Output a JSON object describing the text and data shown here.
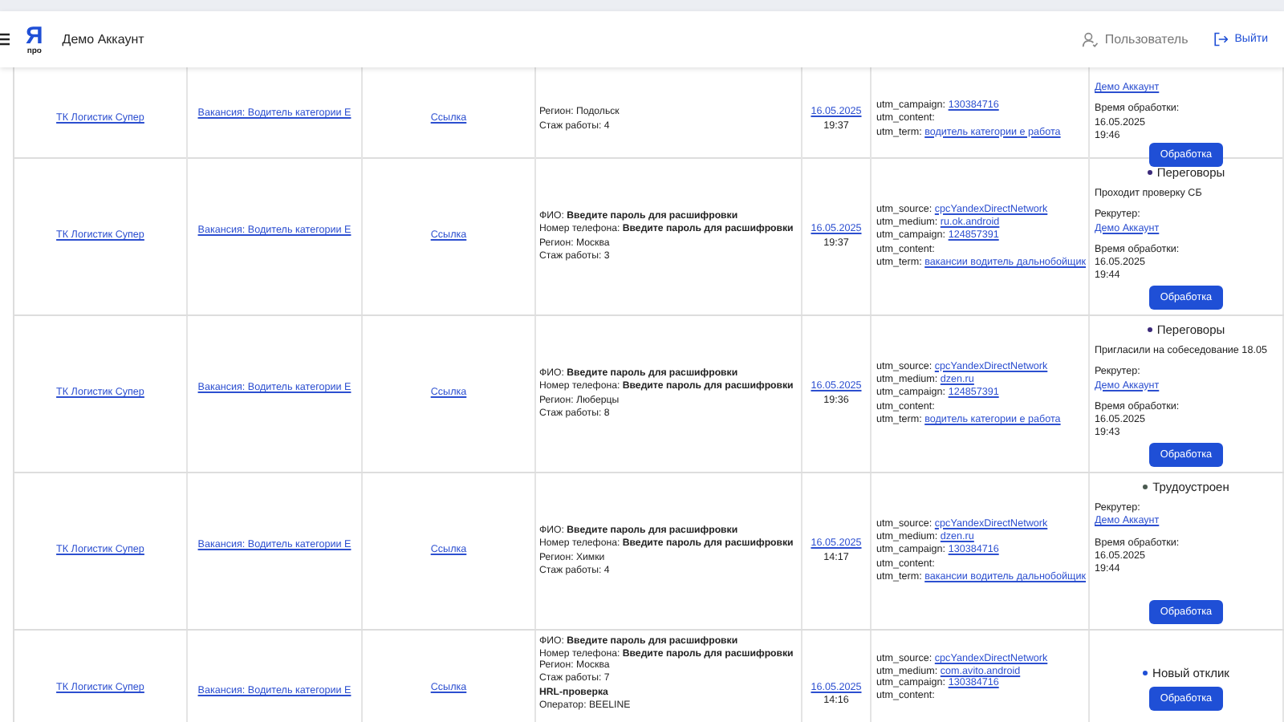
{
  "header": {
    "logo": {
      "letter": "Я",
      "caption": "про"
    },
    "account": "Демо Аккаунт",
    "user": "Пользователь",
    "logout": "Выйти"
  },
  "rows": [
    {
      "company": "ТК Логистик Супер",
      "vacancy": "Вакансия: Водитель категории E",
      "link": "Ссылка",
      "candidate": [
        "Регион: Подольск",
        "Стаж работы: 4"
      ],
      "date": "16.05.2025",
      "time": "19:37",
      "utm": [
        {
          "key": "utm_campaign:",
          "value": "130384716"
        },
        {
          "key": "utm_content:"
        },
        {
          "key": "utm_term:",
          "value": "водитель категории е работа"
        }
      ],
      "recruiter": "Демо Аккаунт",
      "processed_label": "Время обработки:",
      "processed_date": "16.05.2025",
      "processed_time": "19:46",
      "button": "Обработка"
    },
    {
      "company": "ТК Логистик Супер",
      "vacancy": "Вакансия: Водитель категории E",
      "link": "Ссылка",
      "candidate": [
        "ФИО: **Введите пароль для расшифровки**",
        "Номер телефона: **Введите пароль для расшифровки**",
        "Регион: Москва",
        "Стаж работы: 3"
      ],
      "date": "16.05.2025",
      "time": "19:37",
      "utm": [
        {
          "key": "utm_source:",
          "value": "cpcYandexDirectNetwork"
        },
        {
          "key": "utm_medium:",
          "value": "ru.ok.android"
        },
        {
          "key": "utm_campaign:",
          "value": "124857391"
        },
        {
          "key": "utm_content:"
        },
        {
          "key": "utm_term:",
          "value": "вакансии водитель дальнобойщик"
        }
      ],
      "status": {
        "label": "Переговоры",
        "color": "#3b2a7a"
      },
      "comment": "Проходит проверку СБ",
      "recruiter_label": "Рекрутер:",
      "recruiter": "Демо Аккаунт",
      "processed_label": "Время обработки:",
      "processed_date": "16.05.2025",
      "processed_time": "19:44",
      "button": "Обработка"
    },
    {
      "company": "ТК Логистик Супер",
      "vacancy": "Вакансия: Водитель категории E",
      "link": "Ссылка",
      "candidate": [
        "ФИО: **Введите пароль для расшифровки**",
        "Номер телефона: **Введите пароль для расшифровки**",
        "Регион: Люберцы",
        "Стаж работы: 8"
      ],
      "date": "16.05.2025",
      "time": "19:36",
      "utm": [
        {
          "key": "utm_source:",
          "value": "cpcYandexDirectNetwork"
        },
        {
          "key": "utm_medium:",
          "value": "dzen.ru"
        },
        {
          "key": "utm_campaign:",
          "value": "124857391"
        },
        {
          "key": "utm_content:"
        },
        {
          "key": "utm_term:",
          "value": "водитель категории е работа"
        }
      ],
      "status": {
        "label": "Переговоры",
        "color": "#3b2a7a"
      },
      "comment": "Пригласили на собеседование 18.05",
      "recruiter_label": "Рекрутер:",
      "recruiter": "Демо Аккаунт",
      "processed_label": "Время обработки:",
      "processed_date": "16.05.2025",
      "processed_time": "19:43",
      "button": "Обработка"
    },
    {
      "company": "ТК Логистик Супер",
      "vacancy": "Вакансия: Водитель категории E",
      "link": "Ссылка",
      "candidate": [
        "ФИО: **Введите пароль для расшифровки**",
        "Номер телефона: **Введите пароль для расшифровки**",
        "Регион: Химки",
        "Стаж работы: 4"
      ],
      "date": "16.05.2025",
      "time": "14:17",
      "utm": [
        {
          "key": "utm_source:",
          "value": "cpcYandexDirectNetwork"
        },
        {
          "key": "utm_medium:",
          "value": "dzen.ru"
        },
        {
          "key": "utm_campaign:",
          "value": "130384716"
        },
        {
          "key": "utm_content:"
        },
        {
          "key": "utm_term:",
          "value": "вакансии водитель дальнобойщик"
        }
      ],
      "status": {
        "label": "Трудоустроен",
        "color": "#4a5a50"
      },
      "recruiter_label": "Рекрутер:",
      "recruiter": "Демо Аккаунт",
      "processed_label": "Время обработки:",
      "processed_date": "16.05.2025",
      "processed_time": "19:44",
      "button": "Обработка"
    },
    {
      "company": "ТК Логистик Супер",
      "vacancy": "Вакансия: Водитель категории E",
      "link": "Ссылка",
      "candidate": [
        "ФИО: **Введите пароль для расшифровки**",
        "Номер телефона: **Введите пароль для расшифровки**",
        "Регион: Москва",
        "Стаж работы: 7"
      ],
      "hrl": {
        "title": "HRL-проверка",
        "lines": [
          "Оператор: BEELINE"
        ]
      },
      "date": "16.05.2025",
      "time": "14:16",
      "utm": [
        {
          "key": "utm_source:",
          "value": "cpcYandexDirectNetwork"
        },
        {
          "key": "utm_medium:",
          "value": "com.avito.android"
        },
        {
          "key": "utm_campaign:",
          "value": "130384716"
        },
        {
          "key": "utm_content:"
        }
      ],
      "status": {
        "label": "Новый отклик",
        "color": "#1f4fd6"
      },
      "button": "Обработка"
    }
  ]
}
